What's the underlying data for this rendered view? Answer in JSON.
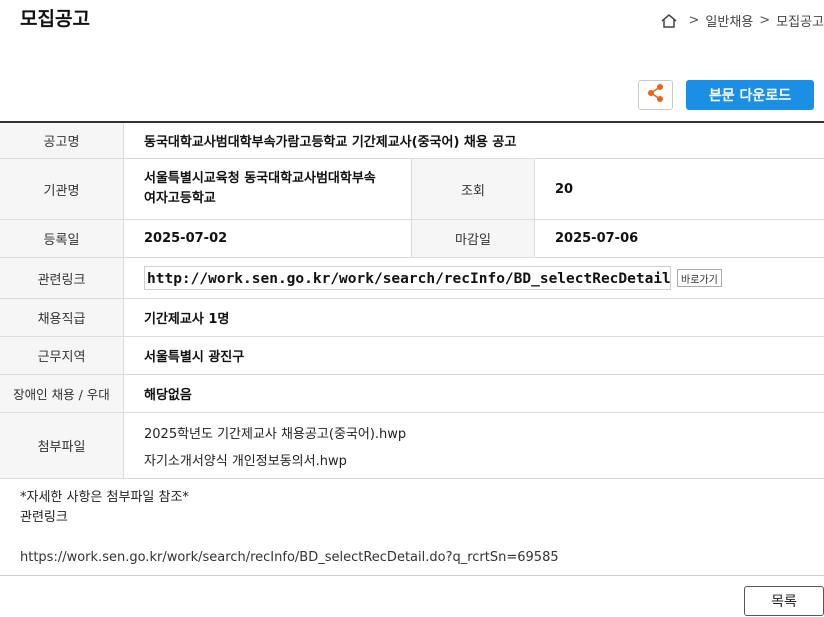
{
  "page": {
    "title": "모집공고"
  },
  "breadcrumb": {
    "items": [
      "일반채용",
      "모집공고"
    ]
  },
  "actions": {
    "download_label": "본문 다운로드",
    "list_label": "목록"
  },
  "details": {
    "title_label": "공고명",
    "title_value": "동국대학교사범대학부속가람고등학교 기간제교사(중국어) 채용 공고",
    "org_label": "기관명",
    "org_value_line1": "서울특별시교육청 동국대학교사범대학부속",
    "org_value_line2": "여자고등학교",
    "views_label": "조회",
    "views_value": "20",
    "reg_label": "등록일",
    "reg_value": "2025-07-02",
    "deadline_label": "마감일",
    "deadline_value": "2025-07-06",
    "link_label": "관련링크",
    "link_value": "http://work.sen.go.kr/work/search/recInfo/BD_selectRecDetail.do?q_rcrtSn=69585",
    "go_label": "바로가기",
    "position_label": "채용직급",
    "position_value": "기간제교사 1명",
    "location_label": "근무지역",
    "location_value": "서울특별시 광진구",
    "disability_label": "장애인 채용 / 우대",
    "disability_value": "해당없음",
    "files_label": "첨부파일",
    "files": [
      "2025학년도 기간제교사 채용공고(중국어).hwp",
      "자기소개서양식 개인정보동의서.hwp"
    ]
  },
  "notes": {
    "line1": "*자세한 사항은 첨부파일 참조*",
    "line2": "관련링크",
    "url": "https://work.sen.go.kr/work/search/recInfo/BD_selectRecDetail.do?q_rcrtSn=69585"
  },
  "colors": {
    "primary": "#1a8fe3",
    "share_icon": "#e8641b",
    "header_bg": "#f6f6f6"
  },
  "icons": {
    "home": "home-icon",
    "share": "share-icon"
  }
}
